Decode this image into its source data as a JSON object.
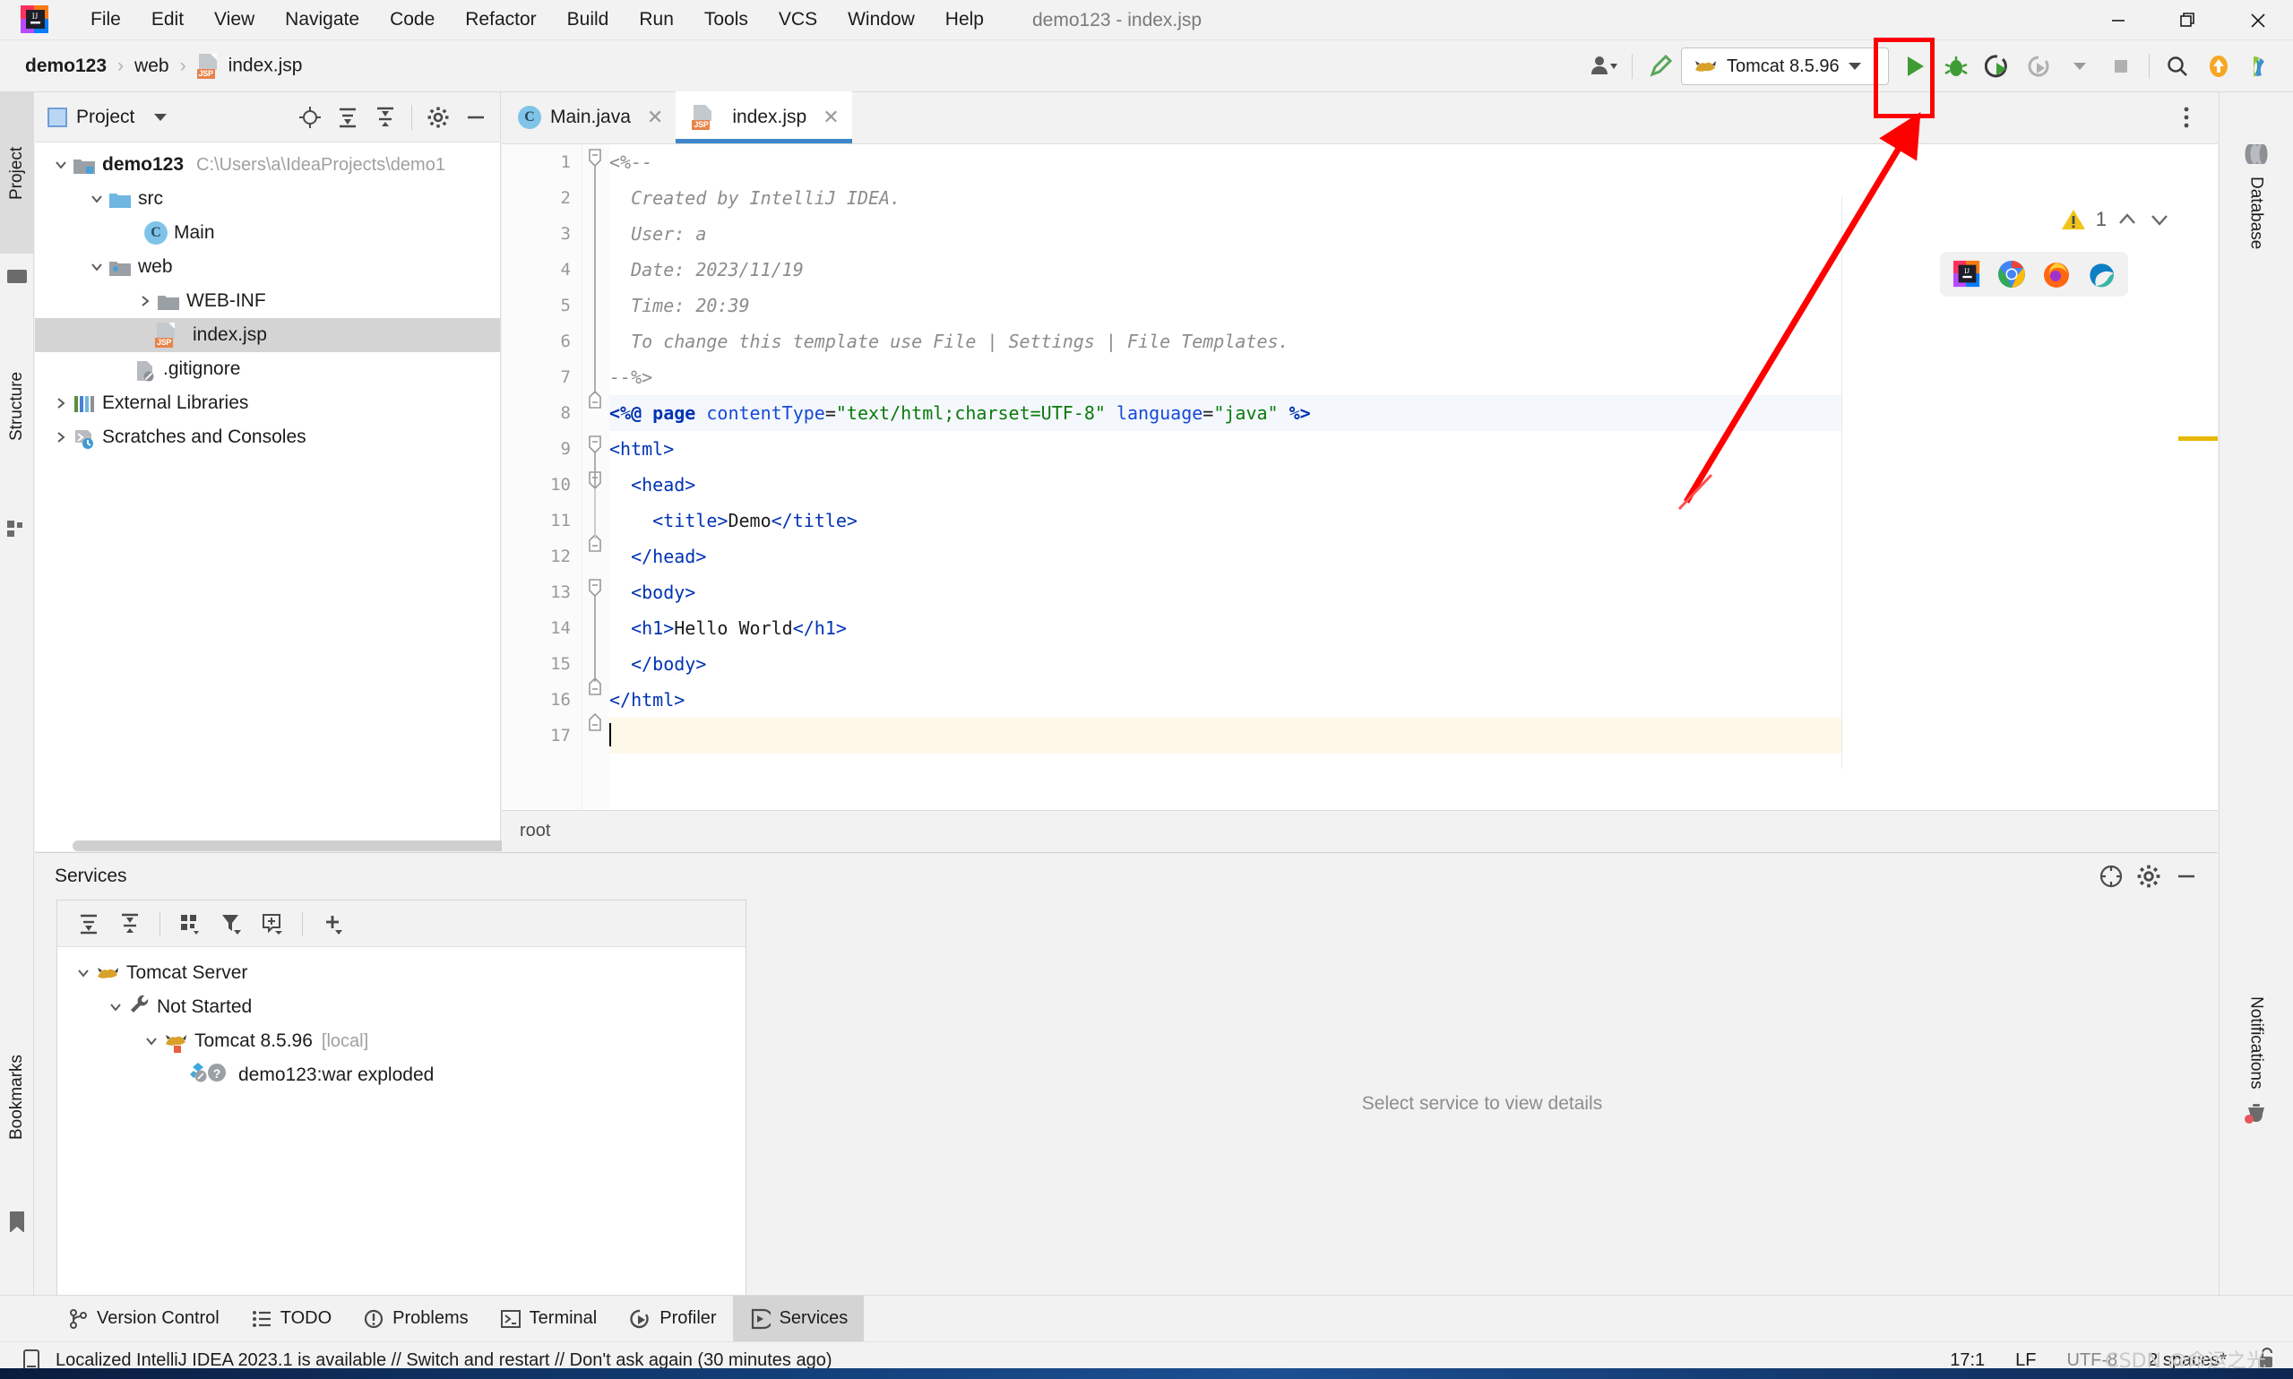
{
  "window": {
    "title": "demo123 - index.jsp",
    "minimize_label": "—",
    "restore_label": "❐",
    "close_label": "✕"
  },
  "menu": [
    {
      "label": "File",
      "mnemonic": "F"
    },
    {
      "label": "Edit",
      "mnemonic": "E"
    },
    {
      "label": "View",
      "mnemonic": "V"
    },
    {
      "label": "Navigate",
      "mnemonic": "N"
    },
    {
      "label": "Code",
      "mnemonic": "C"
    },
    {
      "label": "Refactor",
      "mnemonic": "R"
    },
    {
      "label": "Build",
      "mnemonic": "B"
    },
    {
      "label": "Run",
      "mnemonic": "u"
    },
    {
      "label": "Tools",
      "mnemonic": "T"
    },
    {
      "label": "VCS",
      "mnemonic": "S"
    },
    {
      "label": "Window",
      "mnemonic": "W"
    },
    {
      "label": "Help",
      "mnemonic": "H"
    }
  ],
  "breadcrumb": {
    "items": [
      "demo123",
      "web",
      "index.jsp"
    ],
    "separator": "›"
  },
  "toolbar": {
    "run_config_name": "Tomcat 8.5.96",
    "run_config_icon": "tomcat-cat-icon",
    "buttons": [
      {
        "name": "settings-user-icon",
        "label": ""
      },
      {
        "name": "build-hammer-icon",
        "label": ""
      },
      {
        "name": "run-button",
        "label": ""
      },
      {
        "name": "debug-button",
        "label": ""
      },
      {
        "name": "run-with-coverage-button",
        "label": ""
      },
      {
        "name": "profile-button",
        "label": ""
      },
      {
        "name": "stop-button",
        "label": ""
      },
      {
        "name": "search-everywhere-button",
        "label": ""
      },
      {
        "name": "updates-button",
        "label": ""
      },
      {
        "name": "ide-assistant-button",
        "label": ""
      }
    ]
  },
  "annotation": {
    "highlight_color": "#ff0000",
    "highlight_target": "run-button"
  },
  "left_strip": {
    "tabs": [
      {
        "label": "Project",
        "active": true,
        "icon": "project-icon"
      },
      {
        "label": "Structure",
        "active": false,
        "icon": "structure-icon"
      },
      {
        "label": "Bookmarks",
        "active": false,
        "icon": "bookmark-icon"
      }
    ]
  },
  "right_strip": {
    "tabs": [
      {
        "label": "Database",
        "icon": "database-icon"
      },
      {
        "label": "Notifications",
        "icon": "bell-icon"
      }
    ]
  },
  "project_panel": {
    "title": "Project",
    "toolbar_buttons": [
      "locate-icon",
      "expand-all-icon",
      "collapse-all-icon",
      "gear-icon",
      "hide-icon"
    ],
    "tree": [
      {
        "label": "demo123",
        "path": "C:\\Users\\a\\IdeaProjects\\demo1",
        "depth": 0,
        "expanded": true,
        "icon": "module-folder-icon",
        "bold": true,
        "selected": false
      },
      {
        "label": "src",
        "path": "",
        "depth": 1,
        "expanded": true,
        "icon": "source-folder-icon",
        "bold": false,
        "selected": false
      },
      {
        "label": "Main",
        "path": "",
        "depth": 2,
        "expanded": null,
        "icon": "java-class-icon",
        "bold": false,
        "selected": false
      },
      {
        "label": "web",
        "path": "",
        "depth": 1,
        "expanded": true,
        "icon": "web-folder-icon",
        "bold": false,
        "selected": false
      },
      {
        "label": "WEB-INF",
        "path": "",
        "depth": 2,
        "expanded": false,
        "icon": "folder-icon",
        "bold": false,
        "selected": false
      },
      {
        "label": "index.jsp",
        "path": "",
        "depth": 2,
        "expanded": null,
        "icon": "jsp-file-icon",
        "bold": false,
        "selected": true
      },
      {
        "label": ".gitignore",
        "path": "",
        "depth": 1,
        "expanded": null,
        "icon": "gitignore-file-icon",
        "bold": false,
        "selected": false
      },
      {
        "label": "External Libraries",
        "path": "",
        "depth": 0,
        "expanded": false,
        "icon": "libraries-icon",
        "bold": false,
        "selected": false
      },
      {
        "label": "Scratches and Consoles",
        "path": "",
        "depth": 0,
        "expanded": false,
        "icon": "scratches-icon",
        "bold": false,
        "selected": false
      }
    ]
  },
  "editor": {
    "tabs": [
      {
        "label": "Main.java",
        "icon": "java-class-icon",
        "active": false,
        "close_label": "✕"
      },
      {
        "label": "index.jsp",
        "icon": "jsp-file-icon",
        "active": true,
        "close_label": "✕"
      }
    ],
    "warning_count": "1",
    "warning_icon": "warning-triangle-icon",
    "collapse_icon": "chevron-up-icon",
    "expand_icon": "chevron-down-icon",
    "browsers": [
      "intellij-browser-icon",
      "chrome-icon",
      "firefox-icon",
      "edge-icon"
    ],
    "breadcrumb_bottom": "root",
    "lines": [
      {
        "n": "1",
        "text": "<%--",
        "kind": "comment",
        "fold": "start"
      },
      {
        "n": "2",
        "text": "  Created by IntelliJ IDEA.",
        "kind": "comment",
        "fold": ""
      },
      {
        "n": "3",
        "text": "  User: a",
        "kind": "comment",
        "fold": ""
      },
      {
        "n": "4",
        "text": "  Date: 2023/11/19",
        "kind": "comment",
        "fold": ""
      },
      {
        "n": "5",
        "text": "  Time: 20:39",
        "kind": "comment",
        "fold": ""
      },
      {
        "n": "6",
        "text": "  To change this template use File | Settings | File Templates.",
        "kind": "comment",
        "fold": ""
      },
      {
        "n": "7",
        "text": "--%>",
        "kind": "comment",
        "fold": "end"
      },
      {
        "n": "8",
        "text": "<%@ page contentType=\"text/html;charset=UTF-8\" language=\"java\" %>",
        "kind": "directive",
        "fold": ""
      },
      {
        "n": "9",
        "text": "<html>",
        "kind": "tag",
        "fold": "start"
      },
      {
        "n": "10",
        "text": "  <head>",
        "kind": "tag",
        "fold": "start"
      },
      {
        "n": "11",
        "text": "    <title>Demo</title>",
        "kind": "tag",
        "fold": ""
      },
      {
        "n": "12",
        "text": "  </head>",
        "kind": "tag",
        "fold": "end"
      },
      {
        "n": "13",
        "text": "  <body>",
        "kind": "tag",
        "fold": "start"
      },
      {
        "n": "14",
        "text": "  <h1>Hello World</h1>",
        "kind": "tag",
        "fold": ""
      },
      {
        "n": "15",
        "text": "  </body>",
        "kind": "tag",
        "fold": "end"
      },
      {
        "n": "16",
        "text": "</html>",
        "kind": "tag",
        "fold": "end"
      },
      {
        "n": "17",
        "text": "",
        "kind": "empty",
        "fold": ""
      }
    ]
  },
  "services": {
    "title": "Services",
    "toolbar_buttons": [
      "expand-all-icon",
      "collapse-all-icon",
      "group-icon",
      "filter-icon",
      "add-tab-icon",
      "add-icon"
    ],
    "header_buttons": [
      "help-icon",
      "settings-icon",
      "hide-icon"
    ],
    "tree": [
      {
        "label": "Tomcat Server",
        "suffix": "",
        "depth": 0,
        "expanded": true,
        "icon": "tomcat-cat-icon"
      },
      {
        "label": "Not Started",
        "suffix": "",
        "depth": 1,
        "expanded": true,
        "icon": "wrench-icon"
      },
      {
        "label": "Tomcat 8.5.96",
        "suffix": "[local]",
        "depth": 2,
        "expanded": true,
        "icon": "tomcat-cat-icon"
      },
      {
        "label": "demo123:war exploded",
        "suffix": "",
        "depth": 3,
        "expanded": null,
        "icon": "artifact-icon"
      }
    ],
    "empty_detail_text": "Select service to view details"
  },
  "bottom_tabs": [
    {
      "label": "Version Control",
      "icon": "branch-icon",
      "active": false
    },
    {
      "label": "TODO",
      "icon": "todo-icon",
      "active": false
    },
    {
      "label": "Problems",
      "icon": "problems-icon",
      "active": false
    },
    {
      "label": "Terminal",
      "icon": "terminal-icon",
      "active": false
    },
    {
      "label": "Profiler",
      "icon": "profiler-icon",
      "active": false
    },
    {
      "label": "Services",
      "icon": "services-icon",
      "active": true
    }
  ],
  "status_bar": {
    "message_icon": "notification-icon",
    "message": "Localized IntelliJ IDEA 2023.1 is available // Switch and restart // Don't ask again (30 minutes ago)",
    "caret_position": "17:1",
    "line_separator": "LF",
    "encoding": "UTF-8",
    "indent": "2 spaces*",
    "lock_icon": "unlocked-icon"
  },
  "watermark": "CSDN @命运之光",
  "colors": {
    "accent_blue": "#3e86c9",
    "run_green": "#3f9c35",
    "jsp_orange": "#e8834a",
    "warning_yellow": "#f0c419",
    "annotation_red": "#ff0000",
    "panel_bg": "#f2f2f2",
    "editor_bg": "#ffffff",
    "selection_gray": "#d4d4d4"
  }
}
